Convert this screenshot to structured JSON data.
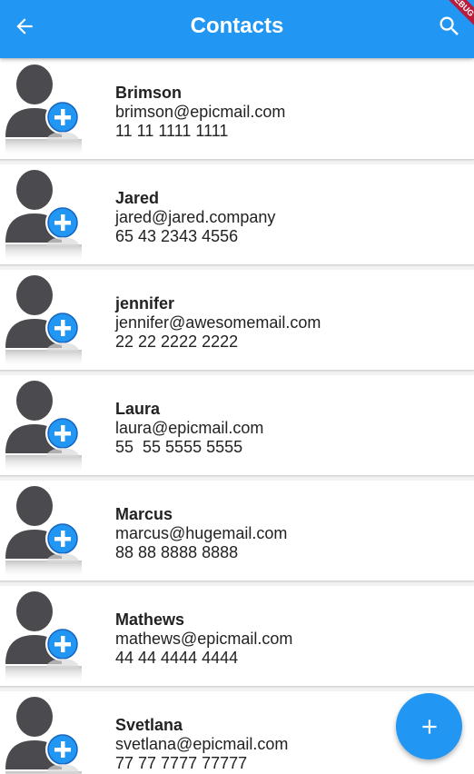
{
  "app": {
    "title": "Contacts",
    "debug_banner": "DEBUG",
    "accent_color": "#2196f3"
  },
  "appbar": {
    "back_icon": "arrow-back-icon",
    "search_icon": "search-icon"
  },
  "contacts": [
    {
      "name": "Brimson",
      "email": "brimson@epicmail.com",
      "phone": "11 11 1111 1111"
    },
    {
      "name": "Jared",
      "email": "jared@jared.company",
      "phone": "65 43 2343 4556"
    },
    {
      "name": "jennifer",
      "email": "jennifer@awesomemail.com",
      "phone": "22 22 2222 2222"
    },
    {
      "name": "Laura",
      "email": "laura@epicmail.com",
      "phone": "55  55 5555 5555"
    },
    {
      "name": "Marcus",
      "email": "marcus@hugemail.com",
      "phone": "88 88 8888 8888"
    },
    {
      "name": "Mathews",
      "email": "mathews@epicmail.com",
      "phone": "44 44 4444 4444"
    },
    {
      "name": "Svetlana",
      "email": "svetlana@epicmail.com",
      "phone": "77 77 7777 77777"
    }
  ],
  "fab": {
    "icon": "plus-icon"
  }
}
